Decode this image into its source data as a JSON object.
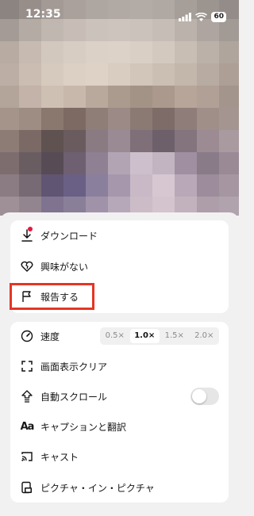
{
  "status_bar": {
    "time": "12:35",
    "battery": "60"
  },
  "menu": {
    "download": "ダウンロード",
    "not_interested": "興味がない",
    "report": "報告する",
    "speed": "速度",
    "speed_options": [
      "0.5×",
      "1.0×",
      "1.5×",
      "2.0×"
    ],
    "speed_selected": "1.0×",
    "clear_display": "画面表示クリア",
    "auto_scroll": "自動スクロール",
    "auto_scroll_on": false,
    "captions": "キャプションと翻訳",
    "captions_icon_text": "Aa",
    "cast": "キャスト",
    "pip": "ピクチャ・イン・ピクチャ"
  },
  "colors": {
    "highlight": "#e63524",
    "notification_dot": "#e5173f"
  }
}
